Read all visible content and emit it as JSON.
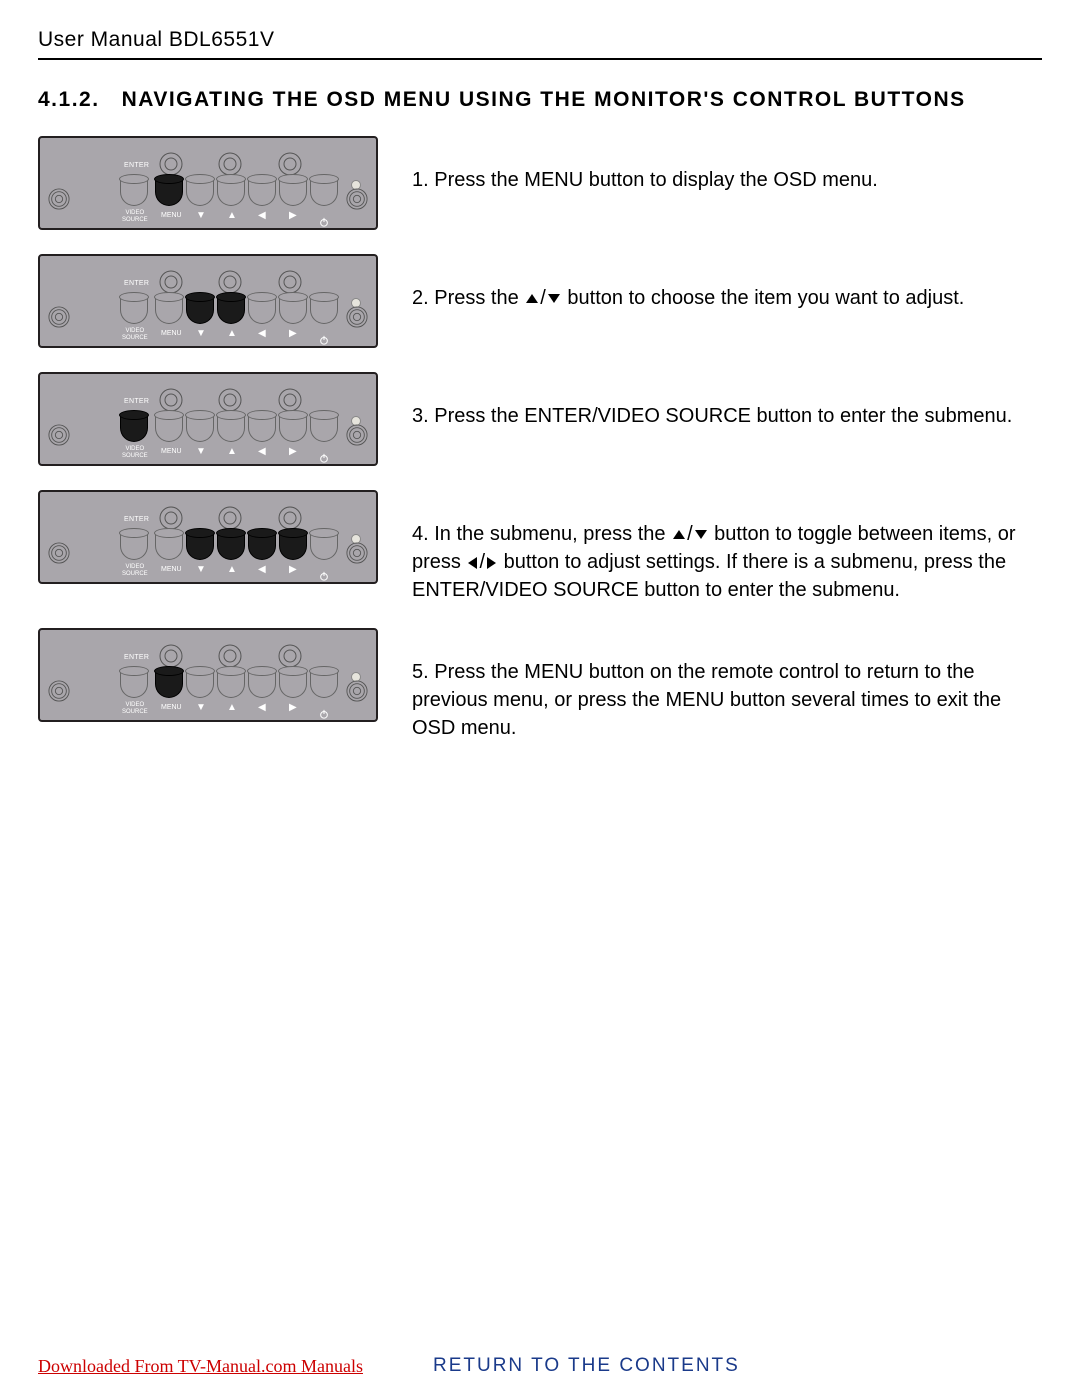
{
  "header": {
    "title": "User Manual BDL6551V"
  },
  "section": {
    "number": "4.1.2.",
    "title": "NAVIGATING THE OSD MENU USING THE MONITOR'S CONTROL BUTTONS"
  },
  "panel_labels": {
    "enter": "ENTER",
    "video_source_l1": "VIDEO",
    "video_source_l2": "SOURCE",
    "menu": "MENU"
  },
  "steps": [
    {
      "num": "1.",
      "segments": [
        {
          "t": "text",
          "v": "Press the "
        },
        {
          "t": "strong",
          "v": "MENU"
        },
        {
          "t": "text",
          "v": " button to display the OSD menu."
        }
      ],
      "highlight": [
        false,
        true,
        false,
        false,
        false,
        false,
        false
      ]
    },
    {
      "num": "2.",
      "segments": [
        {
          "t": "text",
          "v": "Press the "
        },
        {
          "t": "arrow-up"
        },
        {
          "t": "text",
          "v": "/"
        },
        {
          "t": "arrow-down"
        },
        {
          "t": "text",
          "v": " button to choose the item you want to adjust."
        }
      ],
      "highlight": [
        false,
        false,
        true,
        true,
        false,
        false,
        false
      ]
    },
    {
      "num": "3.",
      "segments": [
        {
          "t": "text",
          "v": "Press the "
        },
        {
          "t": "strong",
          "v": "ENTER/VIDEO SOURCE"
        },
        {
          "t": "text",
          "v": " button to enter the submenu."
        }
      ],
      "highlight": [
        true,
        false,
        false,
        false,
        false,
        false,
        false
      ]
    },
    {
      "num": "4.",
      "segments": [
        {
          "t": "text",
          "v": "In the submenu, press the "
        },
        {
          "t": "arrow-up"
        },
        {
          "t": "text",
          "v": "/"
        },
        {
          "t": "arrow-down"
        },
        {
          "t": "text",
          "v": " button to toggle between items, or press "
        },
        {
          "t": "arrow-left"
        },
        {
          "t": "text",
          "v": "/"
        },
        {
          "t": "arrow-right"
        },
        {
          "t": "text",
          "v": " button to adjust settings. If there is a submenu, press the "
        },
        {
          "t": "strong",
          "v": "ENTER/VIDEO SOURCE"
        },
        {
          "t": "text",
          "v": " button to enter the submenu."
        }
      ],
      "highlight": [
        false,
        false,
        true,
        true,
        true,
        true,
        false
      ]
    },
    {
      "num": "5.",
      "segments": [
        {
          "t": "text",
          "v": "Press the "
        },
        {
          "t": "strong",
          "v": "MENU"
        },
        {
          "t": "text",
          "v": " button on the remote control to return to the previous menu, or press the "
        },
        {
          "t": "strong",
          "v": "MENU"
        },
        {
          "t": "text",
          "v": " button several times to exit the OSD menu."
        }
      ],
      "highlight": [
        false,
        true,
        false,
        false,
        false,
        false,
        false
      ]
    }
  ],
  "footer": {
    "download": "Downloaded From TV-Manual.com Manuals",
    "return": "RETURN TO THE CONTENTS"
  }
}
